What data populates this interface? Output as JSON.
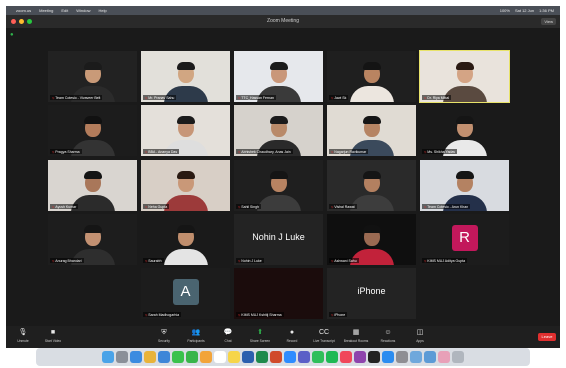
{
  "menubar": {
    "app": "zoom.us",
    "items": [
      "Meeting",
      "Edit",
      "Window",
      "Help"
    ],
    "status": [
      "100%",
      "Sat 12 Jun",
      "1:36 PM"
    ]
  },
  "window": {
    "title": "Zoom Meeting",
    "view_label": "View"
  },
  "tiles": [
    {
      "name": "Team Cotesio - Vivaveer Belt",
      "top": "",
      "kind": "video",
      "wall": "#222222",
      "skin": "#c99a78",
      "hair": "#1b1b1b",
      "shirt": "#2b2b2b"
    },
    {
      "name": "Mr. Pranav Sahu",
      "top": "",
      "kind": "video",
      "wall": "#e2e0da",
      "skin": "#d1a682",
      "hair": "#1b1b1b",
      "shirt": "#2d3a4a"
    },
    {
      "name": "TTC_Hassan Fernan",
      "top": "",
      "kind": "video",
      "wall": "#e6e8ec",
      "skin": "#c9977a",
      "hair": "#1b1b1b",
      "shirt": "#3a3a3a"
    },
    {
      "name": "Jawi Sk",
      "top": "",
      "kind": "video",
      "wall": "#1f1f1f",
      "skin": "#b98461",
      "hair": "#141414",
      "shirt": "#ece6df"
    },
    {
      "name": "Dr. Riya Mittal",
      "top": "",
      "kind": "video",
      "wall": "#e9e3dc",
      "skin": "#d4a485",
      "hair": "#2a1a12",
      "shirt": "#5a4a40"
    },
    {
      "name": "Pragya Sharma",
      "top": "",
      "kind": "video",
      "wall": "#1c1c1c",
      "skin": "#b37c5b",
      "hair": "#111111",
      "shirt": "#333333"
    },
    {
      "name": "BBA - Ananya Das",
      "top": "",
      "kind": "video",
      "wall": "#e4e0da",
      "skin": "#c79677",
      "hair": "#1b1b1b",
      "shirt": "#dedede"
    },
    {
      "name": "Abhishek Chaudhary, Anas Jain",
      "top": "",
      "kind": "video",
      "wall": "#d6d2cc",
      "skin": "#b98a69",
      "hair": "#1b1b1b",
      "shirt": "#2a2a2a"
    },
    {
      "name": "Nagarjun Ravikumar",
      "top": "",
      "kind": "video",
      "wall": "#e0dbd3",
      "skin": "#b68463",
      "hair": "#151515",
      "shirt": "#3b4a5c"
    },
    {
      "name": "Ms. Shikha Yadav",
      "top": "",
      "kind": "video",
      "wall": "#1a1a1a",
      "skin": "#c29070",
      "hair": "#151515",
      "shirt": "#e9e9e9"
    },
    {
      "name": "Ayush Kumar",
      "top": "",
      "kind": "video",
      "wall": "#d9d5d0",
      "skin": "#a9775a",
      "hair": "#141414",
      "shirt": "#2b2b2b"
    },
    {
      "name": "Neha Gupta",
      "top": "",
      "kind": "video",
      "wall": "#d8cfc6",
      "skin": "#c99878",
      "hair": "#2a1a12",
      "shirt": "#9c3a3a"
    },
    {
      "name": "Sahil Singh",
      "top": "",
      "kind": "video",
      "wall": "#1f1f1f",
      "skin": "#b78362",
      "hair": "#151515",
      "shirt": "#3c3c3c"
    },
    {
      "name": "Vishal Rawat",
      "top": "",
      "kind": "video",
      "wall": "#2a2a2a",
      "skin": "#b38060",
      "hair": "#151515",
      "shirt": "#3d3d3d"
    },
    {
      "name": "Team Cotesio - Arun Khan",
      "top": "",
      "kind": "video",
      "wall": "#d8dbe0",
      "skin": "#b48262",
      "hair": "#151515",
      "shirt": "#24304a"
    },
    {
      "name": "Anurag Bhandari",
      "top": "",
      "kind": "video",
      "wall": "#1d1d1d",
      "skin": "#c39172",
      "hair": "#151515",
      "shirt": "#2e2e2e"
    },
    {
      "name": "Saurabh",
      "top": "",
      "kind": "video",
      "wall": "#1a1a1a",
      "skin": "#c08e6d",
      "hair": "#151515",
      "shirt": "#e4e4e4"
    },
    {
      "name": "Nohin J Luke",
      "top": "",
      "kind": "name",
      "display": "Nohin J Luke"
    },
    {
      "name": "Ashwani Sahu",
      "top": "",
      "kind": "video",
      "wall": "#0f0f0f",
      "skin": "#9a6a52",
      "hair": "#111111",
      "shirt": "#c2223a"
    },
    {
      "name": "KIMS MUJ Aditya Gupta",
      "top": "",
      "kind": "avatar",
      "letter": "R",
      "color": "#c2185b"
    },
    {
      "name": "Sarah Madhogarhia",
      "top": "",
      "kind": "avatar",
      "letter": "A",
      "color": "#4a6470"
    },
    {
      "name": "KIMS MUJ Kshitij Sharma",
      "top": "",
      "kind": "blank",
      "wall": "#1b0c0c"
    },
    {
      "name": "iPhone",
      "top": "",
      "kind": "name",
      "display": "iPhone"
    }
  ],
  "toolbar": {
    "left": [
      {
        "label": "Unmute",
        "icon": "mic-icon",
        "glyph": "🎙"
      },
      {
        "label": "Start Video",
        "icon": "camera-icon",
        "glyph": "■"
      }
    ],
    "center": [
      {
        "label": "Security",
        "icon": "shield-icon",
        "glyph": "⛨"
      },
      {
        "label": "Participants",
        "icon": "people-icon",
        "glyph": "👥"
      },
      {
        "label": "Chat",
        "icon": "chat-icon",
        "glyph": "💬"
      },
      {
        "label": "Share Screen",
        "icon": "share-icon",
        "glyph": "⬆"
      },
      {
        "label": "Record",
        "icon": "record-icon",
        "glyph": "●"
      },
      {
        "label": "Live Transcript",
        "icon": "cc-icon",
        "glyph": "CC"
      },
      {
        "label": "Breakout Rooms",
        "icon": "grid-icon",
        "glyph": "▦"
      },
      {
        "label": "Reactions",
        "icon": "emoji-icon",
        "glyph": "☺"
      },
      {
        "label": "Apps",
        "icon": "apps-icon",
        "glyph": "◫"
      }
    ],
    "end_label": "Leave"
  },
  "dock": {
    "apps": [
      "finder-icon",
      "launchpad-icon",
      "safari-icon",
      "chrome-icon",
      "mail-icon",
      "messages-icon",
      "facetime-icon",
      "photos-icon",
      "calendar-icon",
      "notes-icon",
      "word-icon",
      "excel-icon",
      "powerpoint-icon",
      "zoom-icon",
      "teams-icon",
      "whatsapp-icon",
      "spotify-icon",
      "music-icon",
      "podcasts-icon",
      "tv-icon",
      "appstore-icon",
      "settings-icon",
      "preview-icon",
      "files-icon",
      "photos2-icon",
      "trash-icon"
    ],
    "colors": [
      "#4aa3e8",
      "#8a8f98",
      "#3b8be0",
      "#e9b33a",
      "#3e86d8",
      "#3ac24c",
      "#39b54a",
      "#f2a43a",
      "#ffffff",
      "#f6d54a",
      "#2b5fae",
      "#1e8a4c",
      "#d04a2a",
      "#2d8cff",
      "#5b5fc7",
      "#2fbf5a",
      "#1db954",
      "#f0475a",
      "#8e44ad",
      "#222222",
      "#2b8cf0",
      "#8e8e93",
      "#6fa8dc",
      "#5c9bd6",
      "#e8a0b8",
      "#b0b6be"
    ]
  }
}
